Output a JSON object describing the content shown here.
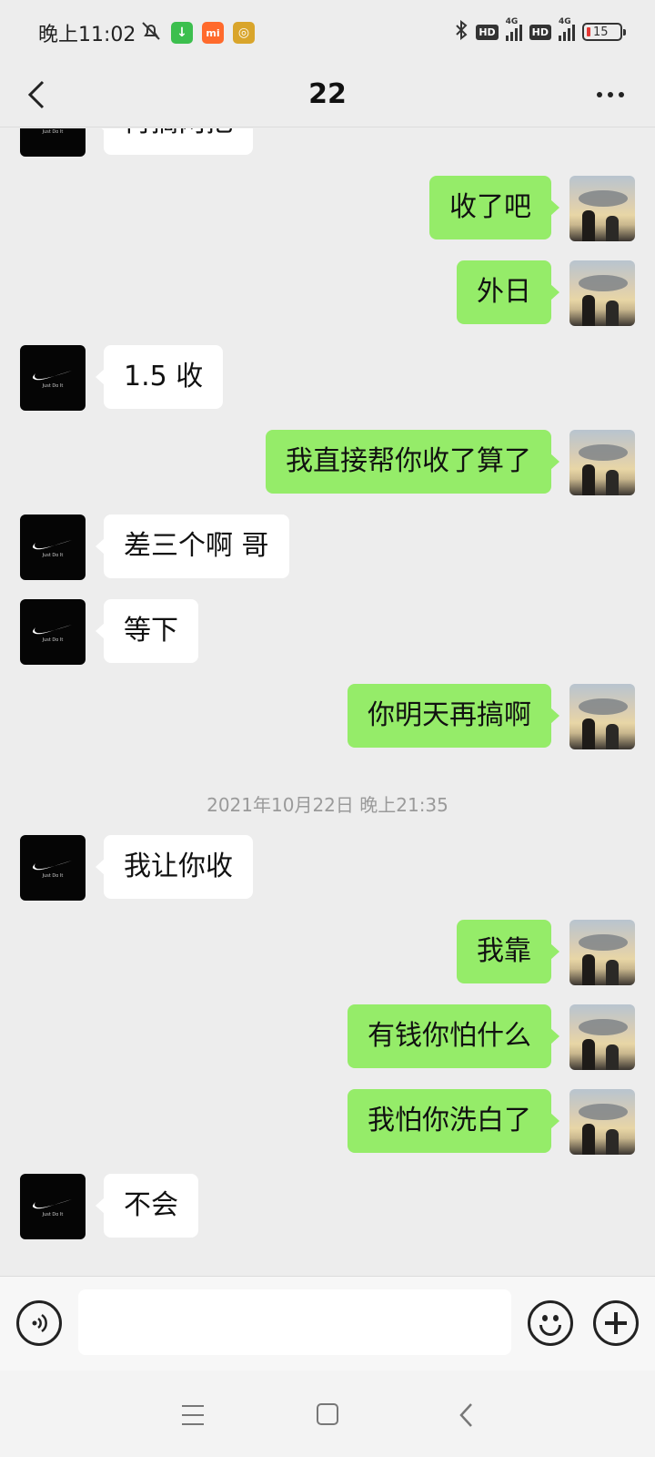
{
  "status_bar": {
    "time": "晚上11:02",
    "battery": "15",
    "hd_badge": "HD",
    "network": "4G",
    "app_badge": "mi"
  },
  "header": {
    "title": "22",
    "back_icon": "chevron-left-icon",
    "more_icon": "more-dots-icon"
  },
  "messages": [
    {
      "side": "left",
      "text": "再搞两把",
      "avatar": "nike-swoosh"
    },
    {
      "side": "right",
      "text": "收了吧",
      "avatar": "sky-photo"
    },
    {
      "side": "right",
      "text": "外日",
      "avatar": "sky-photo"
    },
    {
      "side": "left",
      "text": "1.5 收",
      "avatar": "nike-swoosh"
    },
    {
      "side": "right",
      "text": "我直接帮你收了算了",
      "avatar": "sky-photo"
    },
    {
      "side": "left",
      "text": "差三个啊 哥",
      "avatar": "nike-swoosh"
    },
    {
      "side": "left",
      "text": "等下",
      "avatar": "nike-swoosh"
    },
    {
      "side": "right",
      "text": "你明天再搞啊",
      "avatar": "sky-photo"
    },
    {
      "side": "left",
      "text": "我让你收",
      "avatar": "nike-swoosh"
    },
    {
      "side": "right",
      "text": "我靠",
      "avatar": "sky-photo"
    },
    {
      "side": "right",
      "text": "有钱你怕什么",
      "avatar": "sky-photo"
    },
    {
      "side": "right",
      "text": "我怕你洗白了",
      "avatar": "sky-photo"
    },
    {
      "side": "left",
      "text": "不会",
      "avatar": "nike-swoosh"
    }
  ],
  "timestamp_separator": "2021年10月22日 晚上21:35",
  "nike_caption": "Just Do It",
  "input_bar": {
    "value": "",
    "voice_icon": "voice-icon",
    "emoji_icon": "emoji-icon",
    "plus_icon": "plus-icon"
  },
  "system_nav": {
    "menu_icon": "menu-icon",
    "home_icon": "home-icon",
    "back_icon": "back-icon"
  },
  "colors": {
    "background": "#ededed",
    "outgoing_bubble": "#95ec69",
    "incoming_bubble": "#ffffff"
  }
}
